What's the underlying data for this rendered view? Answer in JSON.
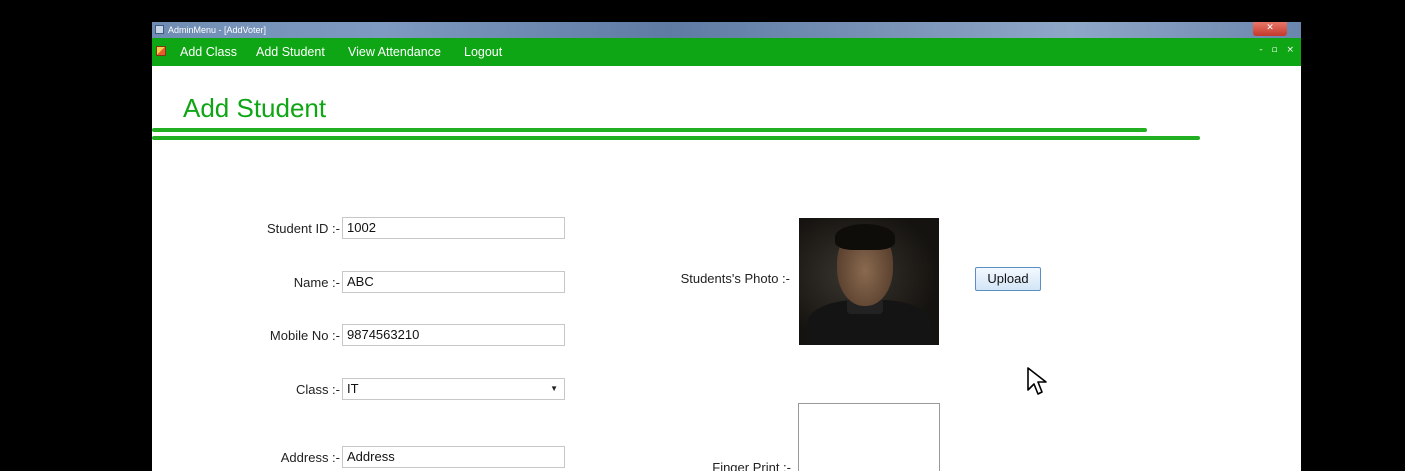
{
  "window": {
    "title": "AdminMenu - [AddVoter]",
    "close_glyph": "✕",
    "mdi_controls": "- ▫ ×"
  },
  "menu": {
    "items": [
      {
        "label": "Add Class"
      },
      {
        "label": "Add Student"
      },
      {
        "label": "View Attendance"
      },
      {
        "label": "Logout"
      }
    ]
  },
  "page": {
    "title": "Add Student"
  },
  "form": {
    "student_id": {
      "label": "Student ID  :-",
      "value": "1002"
    },
    "name": {
      "label": "Name  :-",
      "value": "ABC"
    },
    "mobile": {
      "label": "Mobile No  :-",
      "value": "9874563210"
    },
    "class": {
      "label": "Class  :-",
      "value": "IT"
    },
    "address": {
      "label": "Address  :-",
      "value": "Address"
    },
    "photo": {
      "label": "Students's Photo  :-"
    },
    "upload_button": "Upload",
    "fingerprint": {
      "label": "Finger Print  :-"
    }
  },
  "colors": {
    "menubar": "#0ea614",
    "title_green": "#0ea614"
  },
  "icons": [
    "app-icon",
    "menu-app-icon",
    "close-icon",
    "dropdown-arrow-icon",
    "mouse-cursor-icon"
  ]
}
